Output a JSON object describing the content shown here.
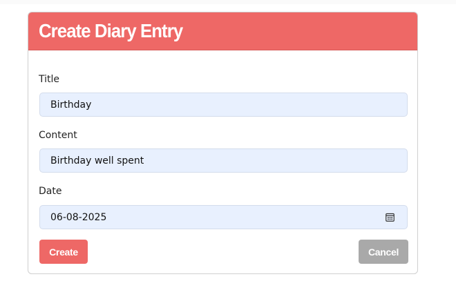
{
  "header": {
    "title": "Create Diary Entry"
  },
  "form": {
    "title_label": "Title",
    "title_value": "Birthday",
    "content_label": "Content",
    "content_value": "Birthday well spent",
    "date_label": "Date",
    "date_value": "06-08-2025",
    "date_icon": "calendar-icon"
  },
  "actions": {
    "create_label": "Create",
    "cancel_label": "Cancel"
  },
  "colors": {
    "accent": "#ee6866",
    "input_bg": "#e8f0fe",
    "cancel_bg": "#a9a9a9"
  }
}
